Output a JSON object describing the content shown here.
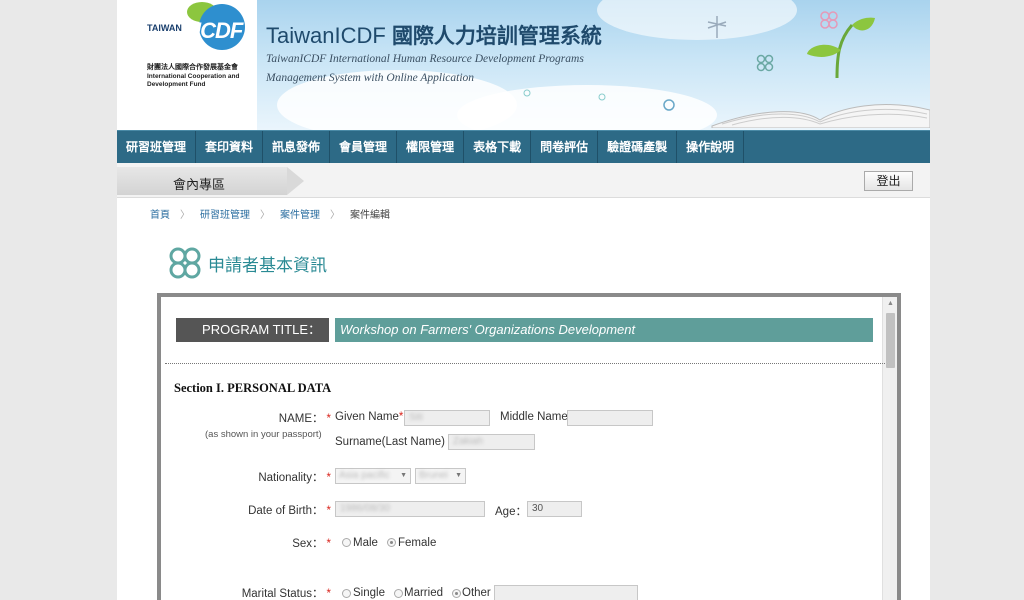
{
  "logo": {
    "taiwan": "TAIWAN",
    "icdf": "ICDF",
    "org_zh": "財團法人國際合作發展基金會",
    "org_en": "International Cooperation and Development Fund"
  },
  "header": {
    "title_en": "TaiwanICDF",
    "title_zh": "國際人力培訓管理系統",
    "subtitle_1": "TaiwanICDF International Human Resource Development Programs",
    "subtitle_2": "Management System with Online Application"
  },
  "nav": {
    "items": [
      {
        "label": "研習班管理"
      },
      {
        "label": "套印資料"
      },
      {
        "label": "訊息發佈"
      },
      {
        "label": "會員管理"
      },
      {
        "label": "權限管理"
      },
      {
        "label": "表格下載"
      },
      {
        "label": "問卷評估"
      },
      {
        "label": "驗證碼產製"
      },
      {
        "label": "操作說明"
      }
    ]
  },
  "member_bar": {
    "label": "會內專區",
    "logout_label": "登出"
  },
  "breadcrumb": {
    "items": [
      "首頁",
      "研習班管理",
      "案件管理",
      "案件編輯"
    ]
  },
  "section": {
    "title": "申請者基本資訊"
  },
  "form": {
    "program_title_label": "PROGRAM TITLE：",
    "program_title_value": "Workshop on Farmers' Organizations Development",
    "section_heading": "Section I. PERSONAL DATA",
    "name_label": "NAME：",
    "name_note": "(as shown in your passport)",
    "given_name_label": "Given Name",
    "given_name_value": "Siti",
    "middle_name_label": "Middle Name",
    "middle_name_value": "",
    "surname_label": "Surname(Last Name)",
    "surname_value": "Zakiah",
    "nationality_label": "Nationality：",
    "nationality_region": "Asia pacific",
    "nationality_country": "Brunei",
    "dob_label": "Date of Birth：",
    "dob_value": "1986/08/30",
    "age_label": "Age：",
    "age_value": "30",
    "sex_label": "Sex：",
    "sex_options": [
      "Male",
      "Female"
    ],
    "sex_selected": "Female",
    "marital_label": "Marital Status：",
    "marital_options": [
      "Single",
      "Married",
      "Other"
    ],
    "marital_selected": "Other",
    "marital_other_value": "",
    "required_mark": "*"
  },
  "colors": {
    "nav_bg": "#2d6a86",
    "program_label_bg": "#555555",
    "program_value_bg": "#5f9e9a",
    "section_title": "#2a8a94",
    "required": "#d9251d"
  }
}
